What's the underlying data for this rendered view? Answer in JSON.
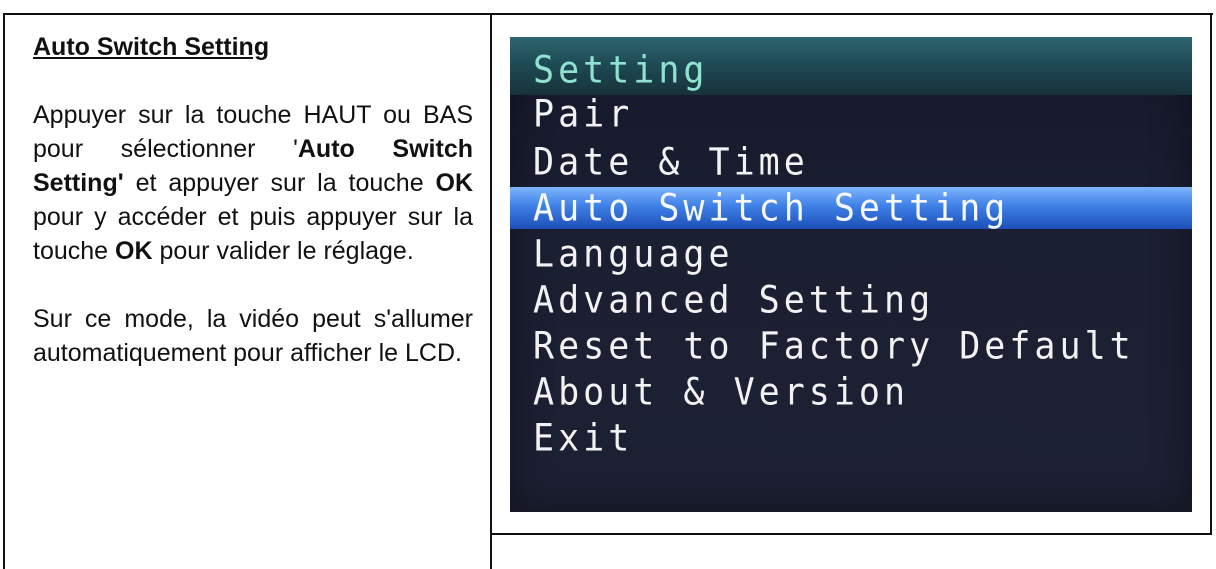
{
  "left": {
    "heading": "Auto Switch Setting",
    "para1": {
      "p1": "Appuyer sur la touche HAUT ou BAS pour sélectionner '",
      "b1": "Auto Switch Setting'",
      "p2": " et appuyer sur la touche ",
      "b2": "OK",
      "p3": " pour y accéder et puis appuyer sur la touche ",
      "b3": "OK",
      "p4": " pour valider le réglage."
    },
    "para2": "Sur ce mode, la vidéo peut s'allumer automatiquement pour afficher le LCD."
  },
  "osd": {
    "title": "Setting",
    "items": [
      "Pair",
      "Date & Time",
      "Auto Switch Setting",
      "Language",
      "Advanced Setting",
      "Reset to Factory Default",
      "About & Version",
      "Exit"
    ],
    "selected_index": 2,
    "colors": {
      "title_text": "#8fe2cf",
      "title_bar": "#1f4b56",
      "highlight": "#3e80e6",
      "background": "#1b1f32",
      "item_text": "#f2f2f2"
    }
  }
}
